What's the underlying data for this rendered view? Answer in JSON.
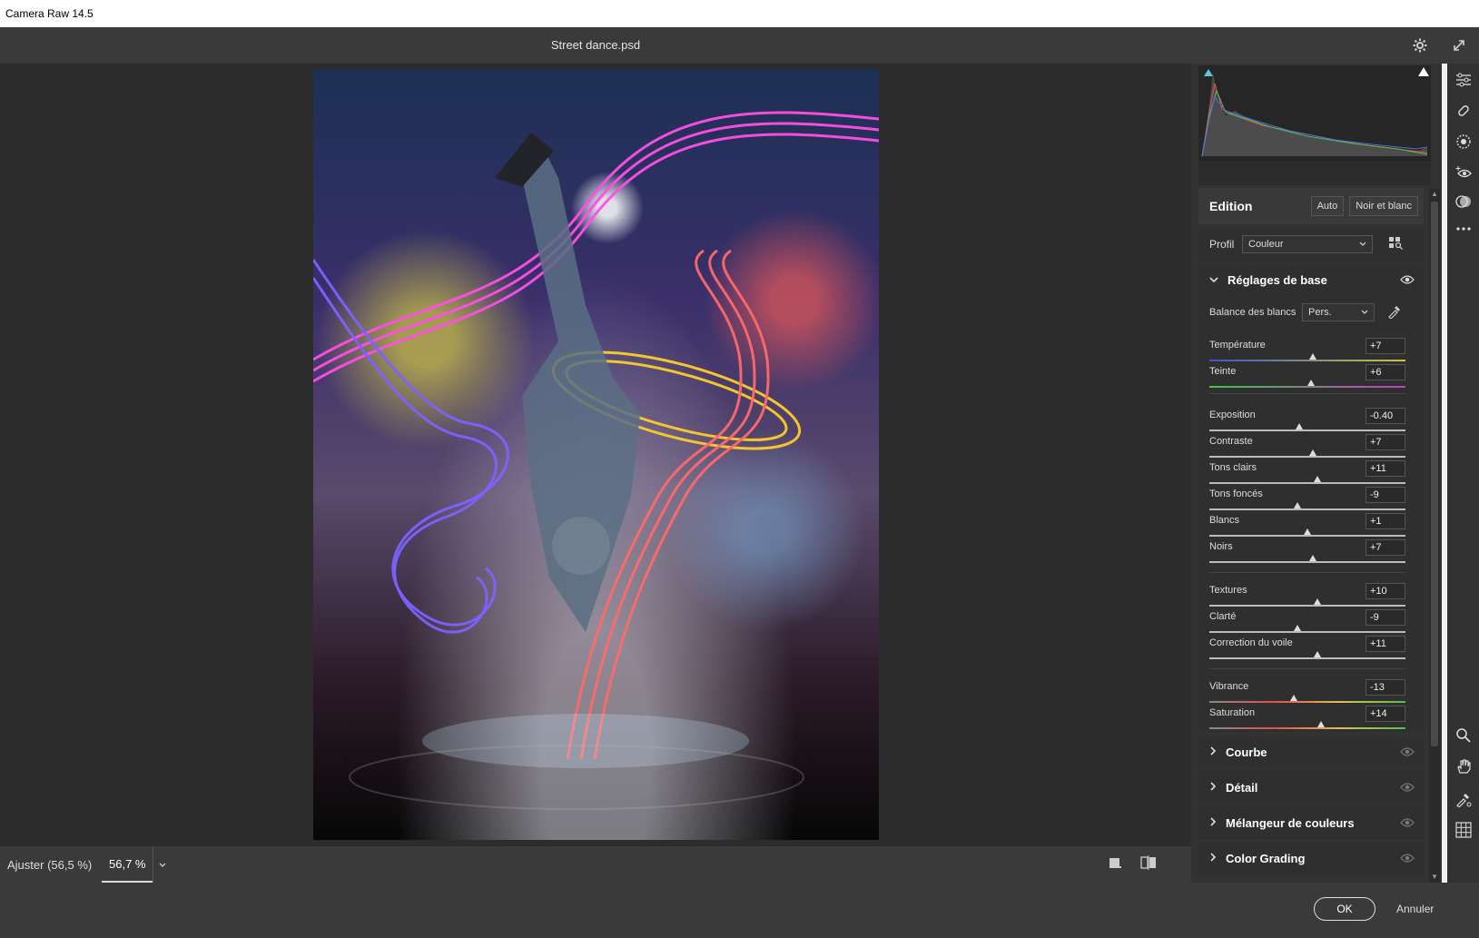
{
  "os": {
    "title": "Camera Raw 14.5"
  },
  "header": {
    "document": "Street dance.psd",
    "icons": [
      "gear-icon",
      "fullscreen-icon"
    ]
  },
  "canvas_footer": {
    "fit_label": "Ajuster (56,5 %)",
    "zoom_value": "56,7 %"
  },
  "edit": {
    "title": "Edition",
    "auto_label": "Auto",
    "bw_label": "Noir et blanc",
    "profile_label": "Profil",
    "profile_value": "Couleur"
  },
  "basic": {
    "title": "Réglages de base",
    "wb_label": "Balance des blancs",
    "wb_value": "Pers.",
    "sliders": [
      {
        "label": "Température",
        "value": "+7",
        "pos": 0.53
      },
      {
        "label": "Teinte",
        "value": "+6",
        "pos": 0.52
      },
      {
        "label": "Exposition",
        "value": "-0.40",
        "pos": 0.46
      },
      {
        "label": "Contraste",
        "value": "+7",
        "pos": 0.53
      },
      {
        "label": "Tons clairs",
        "value": "+11",
        "pos": 0.55
      },
      {
        "label": "Tons foncés",
        "value": "-9",
        "pos": 0.45
      },
      {
        "label": "Blancs",
        "value": "+1",
        "pos": 0.5
      },
      {
        "label": "Noirs",
        "value": "+7",
        "pos": 0.53
      },
      {
        "label": "Textures",
        "value": "+10",
        "pos": 0.55
      },
      {
        "label": "Clarté",
        "value": "-9",
        "pos": 0.45
      },
      {
        "label": "Correction du voile",
        "value": "+11",
        "pos": 0.55
      },
      {
        "label": "Vibrance",
        "value": "-13",
        "pos": 0.43
      },
      {
        "label": "Saturation",
        "value": "+14",
        "pos": 0.57
      }
    ]
  },
  "sections": [
    {
      "title": "Courbe"
    },
    {
      "title": "Détail"
    },
    {
      "title": "Mélangeur de couleurs"
    },
    {
      "title": "Color Grading"
    }
  ],
  "footer": {
    "ok": "OK",
    "cancel": "Annuler"
  },
  "colors": {
    "accent": "#5ac8d8",
    "panel": "#323232",
    "canvas": "#2c2c2c"
  }
}
